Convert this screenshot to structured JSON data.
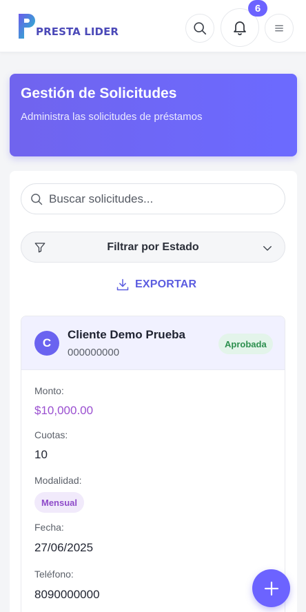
{
  "header": {
    "logo_text": "PRESTA LIDER",
    "notification_count": "6"
  },
  "hero": {
    "title": "Gestión de Solicitudes",
    "subtitle": "Administra las solicitudes de préstamos"
  },
  "search": {
    "placeholder": "Buscar solicitudes..."
  },
  "filter": {
    "label": "Filtrar por Estado"
  },
  "export": {
    "label": "EXPORTAR"
  },
  "request": {
    "avatar_initial": "C",
    "client_name": "Cliente Demo Prueba",
    "client_id": "000000000",
    "status": "Aprobada",
    "amount_label": "Monto:",
    "amount": "$10,000.00",
    "installments_label": "Cuotas:",
    "installments": "10",
    "mode_label": "Modalidad:",
    "mode": "Mensual",
    "date_label": "Fecha:",
    "date": "27/06/2025",
    "phone_label": "Teléfono:",
    "phone": "8090000000"
  },
  "colors": {
    "accent": "#6c63ff",
    "amount": "#9a4fd0",
    "status_green": "#2c8f4e"
  },
  "icons": {
    "search": "search-icon",
    "bell": "bell-icon",
    "menu": "menu-icon",
    "filter": "filter-icon",
    "chevron": "chevron-down-icon",
    "download": "download-icon",
    "add": "plus-icon"
  }
}
